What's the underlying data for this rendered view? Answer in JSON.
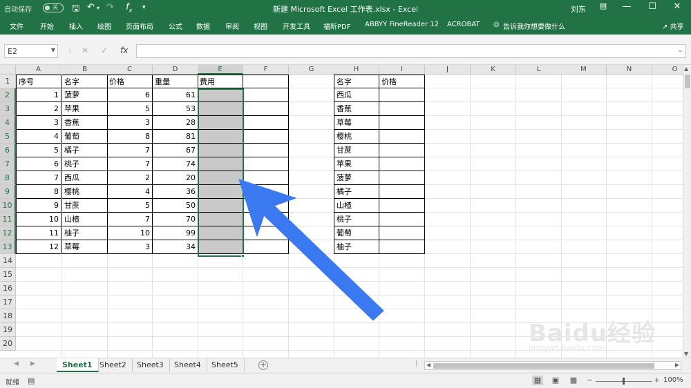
{
  "titlebar": {
    "autosave_label": "自动保存",
    "autosave_state": "关",
    "document_title": "新建 Microsoft Excel 工作表.xlsx  -  Excel",
    "user_name": "刘东"
  },
  "ribbon": {
    "tabs": [
      "文件",
      "开始",
      "插入",
      "绘图",
      "页面布局",
      "公式",
      "数据",
      "审阅",
      "视图",
      "开发工具",
      "福昕PDF",
      "ABBYY FineReader 12",
      "ACROBAT"
    ],
    "tell_me": "告诉我你想要做什么",
    "share": "共享"
  },
  "formula_bar": {
    "name_box": "E2",
    "formula": ""
  },
  "columns": [
    "A",
    "B",
    "C",
    "D",
    "E",
    "F",
    "G",
    "H",
    "I",
    "J",
    "K",
    "L",
    "M",
    "N",
    "O"
  ],
  "rows": [
    "1",
    "2",
    "3",
    "4",
    "5",
    "6",
    "7",
    "8",
    "9",
    "10",
    "11",
    "12",
    "13",
    "14",
    "15",
    "16",
    "17",
    "18",
    "19",
    "20"
  ],
  "table1": {
    "headers": [
      "序号",
      "名字",
      "价格",
      "重量",
      "费用"
    ],
    "rows": [
      [
        "1",
        "菠萝",
        "6",
        "61"
      ],
      [
        "2",
        "苹果",
        "5",
        "53"
      ],
      [
        "3",
        "香蕉",
        "3",
        "28"
      ],
      [
        "4",
        "葡萄",
        "8",
        "81"
      ],
      [
        "5",
        "橘子",
        "7",
        "67"
      ],
      [
        "6",
        "桃子",
        "7",
        "74"
      ],
      [
        "7",
        "西瓜",
        "2",
        "20"
      ],
      [
        "8",
        "樱桃",
        "4",
        "36"
      ],
      [
        "9",
        "甘蔗",
        "5",
        "50"
      ],
      [
        "10",
        "山楂",
        "7",
        "70"
      ],
      [
        "11",
        "柚子",
        "10",
        "99"
      ],
      [
        "12",
        "草莓",
        "3",
        "34"
      ]
    ]
  },
  "table2": {
    "headers": [
      "名字",
      "价格"
    ],
    "names": [
      "西瓜",
      "香蕉",
      "草莓",
      "樱桃",
      "甘蔗",
      "苹果",
      "菠萝",
      "橘子",
      "山楂",
      "桃子",
      "葡萄",
      "柚子"
    ]
  },
  "sheets": [
    "Sheet1",
    "Sheet2",
    "Sheet3",
    "Sheet4",
    "Sheet5"
  ],
  "status": {
    "mode": "就绪",
    "zoom": "100%"
  },
  "watermark": {
    "logo": "Baidu经验",
    "url": "jingyan.baidu.com"
  },
  "colors": {
    "excel_green": "#217346",
    "arrow_blue": "#3b79f0",
    "shaded_cell": "#c9c9c9"
  }
}
